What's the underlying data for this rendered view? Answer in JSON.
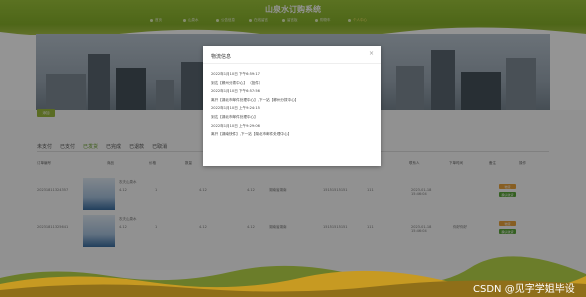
{
  "site": {
    "title": "山泉水订购系统"
  },
  "nav": [
    {
      "label": "首页",
      "active": false
    },
    {
      "label": "山泉水",
      "active": false
    },
    {
      "label": "公告信息",
      "active": false
    },
    {
      "label": "在线留言",
      "active": false
    },
    {
      "label": "留言板",
      "active": false
    },
    {
      "label": "购物车",
      "active": false
    },
    {
      "label": "个人中心",
      "active": true
    }
  ],
  "page": {
    "add_button": "添加",
    "tabs": [
      {
        "label": "未支付",
        "active": false
      },
      {
        "label": "已支付",
        "active": false
      },
      {
        "label": "已发货",
        "active": true
      },
      {
        "label": "已完成",
        "active": false
      },
      {
        "label": "已退款",
        "active": false
      },
      {
        "label": "已取消",
        "active": false
      }
    ],
    "columns": [
      "订单编号",
      "商品",
      "价格",
      "数量",
      "折扣价",
      "总价格",
      "收货地址",
      "电话",
      "联系人",
      "下单时间",
      "备注",
      "操作"
    ],
    "rows": [
      {
        "order_no": "20231811324357",
        "product": "农夫山泉水",
        "price": "4.12",
        "qty": "1",
        "discount": "4.12",
        "total": "4.12",
        "address": "湖南省湖南",
        "phone": "15151515151",
        "contact": "111",
        "time": "2023-01-18 15:46:04",
        "note": "",
        "actions": [
          "物流",
          "确认收货"
        ]
      },
      {
        "order_no": "20231811325641",
        "product": "农夫山泉水",
        "price": "4.12",
        "qty": "1",
        "discount": "4.12",
        "total": "4.12",
        "address": "湖南省湖南",
        "phone": "15151515151",
        "contact": "111",
        "time": "2023-01-18 15:46:04",
        "note": "你好你好",
        "actions": [
          "物流",
          "确认收货"
        ]
      }
    ]
  },
  "modal": {
    "title": "物流信息",
    "close": "×",
    "lines": [
      "2022年1月10日 下午6:59:17",
      "到达【郴州分拨中心】 （投件）",
      "2022年1月10日 下午6:57:56",
      "离开【湖北市邮件处理中心】,下一站【郴州分拨中心】",
      "2022年1月10日 上午9:24:15",
      "到达【湖北市邮件处理中心】",
      "2022年1月10日 上午9:29:06",
      "离开【湖南快件】,下一站【湖北市邮件处理中心】"
    ]
  },
  "watermark": "CSDN @见字学姐毕设"
}
